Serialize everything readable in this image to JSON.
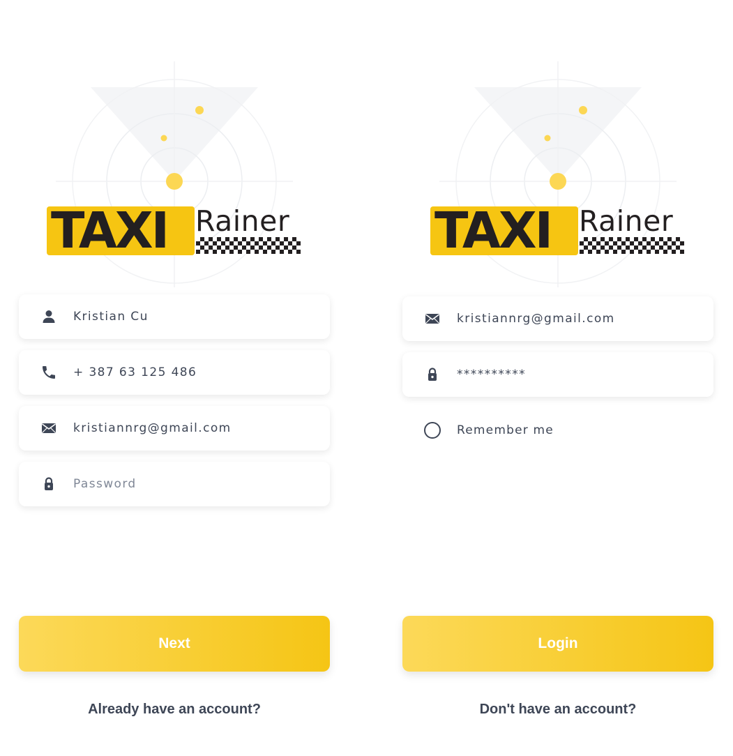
{
  "brand": {
    "taxi_text": "TAXI",
    "rainer_text": "Rainer",
    "yellow": "#f6c512",
    "dark": "#231f20"
  },
  "signup": {
    "name_value": "Kristian Cu",
    "phone_value": "+ 387 63 125 486",
    "email_value": "kristiannrg@gmail.com",
    "password_placeholder": "Password",
    "next_label": "Next",
    "login_link": "Already have an account?"
  },
  "login": {
    "email_value": "kristiannrg@gmail.com",
    "password_value": "**********",
    "remember_label": "Remember me",
    "login_label": "Login",
    "signup_link": "Don't have an account?"
  },
  "icons": {
    "name": "user-icon",
    "phone": "phone-icon",
    "email": "mail-icon",
    "password": "lock-icon"
  }
}
